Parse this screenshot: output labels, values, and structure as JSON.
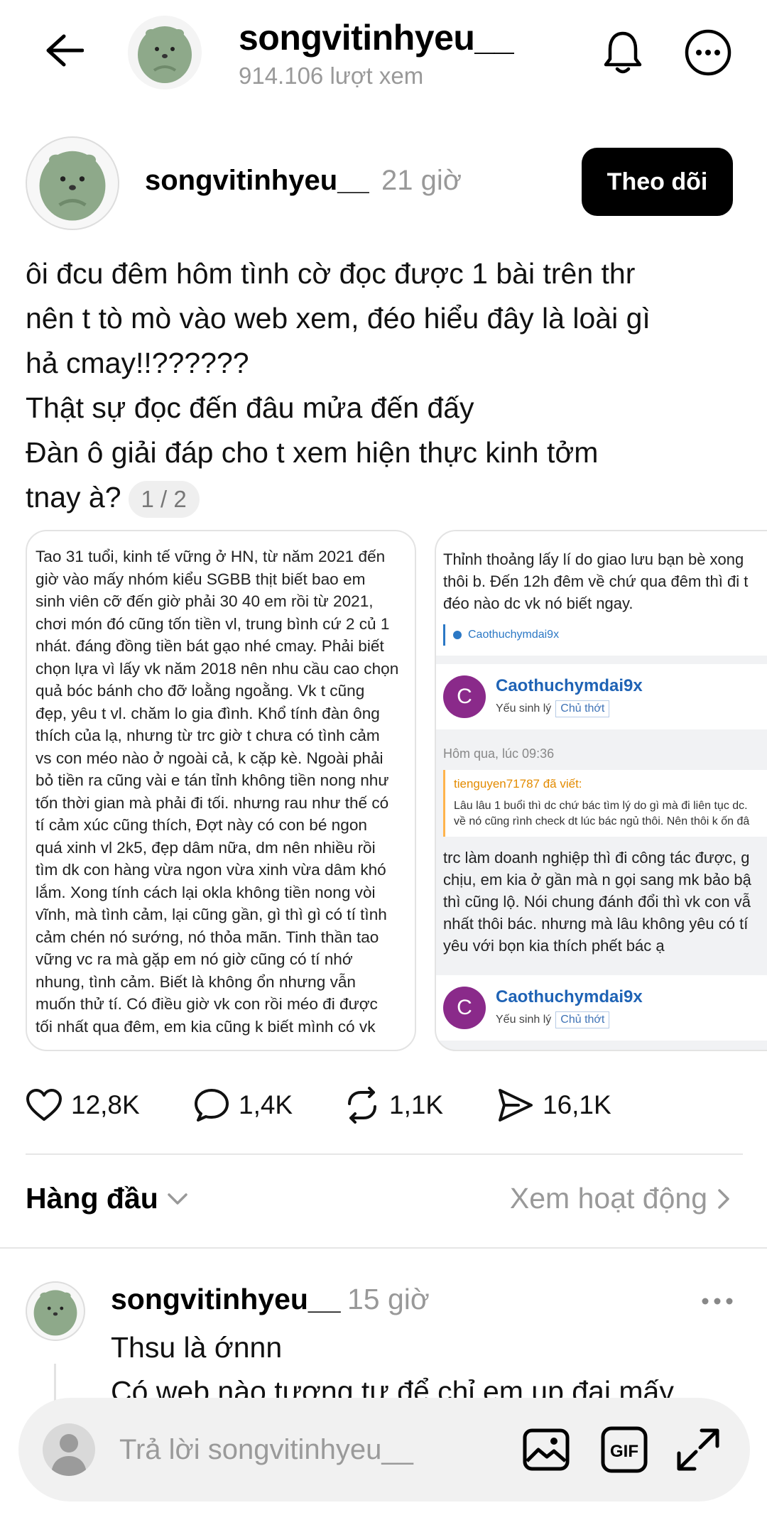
{
  "header": {
    "title": "songvitinhyeu__",
    "views": "914.106 lượt xem"
  },
  "post": {
    "author": "songvitinhyeu__",
    "time": "21 giờ",
    "follow_label": "Theo dõi",
    "text_lines": [
      "ôi đcu đêm hôm tình cờ đọc được 1 bài trên thr",
      "nên t tò mò vào web xem, đéo hiểu đây là loài gì",
      "hả cmay!!??????",
      "Thật sự đọc đến đâu mửa đến đấy",
      "Đàn ô giải đáp cho t xem hiện thực kinh tởm",
      "tnay à?"
    ],
    "image_counter": "1 / 2",
    "image1_lines": [
      "Tao 31 tuổi, kinh tế vững ở HN, từ năm 2021 đến",
      "giờ vào mấy nhóm kiểu SGBB thịt biết bao em",
      "sinh viên cỡ đến giờ phải 30 40 em rồi từ 2021,",
      "chơi món đó cũng tốn tiền vl, trung bình cứ 2 củ 1",
      "nhát. đáng đồng tiền bát gạo nhé cmay. Phải biết",
      "chọn lựa vì lấy vk năm 2018 nên nhu cầu cao chọn",
      "quả bóc bánh cho đỡ loằng ngoằng. Vk t cũng",
      "đẹp, yêu t vl. chăm lo gia đình. Khổ tính đàn ông",
      "thích của lạ, nhưng từ trc giờ t chưa có tình cảm",
      "vs con méo nào ở ngoài cả, k cặp kè. Ngoài phải",
      "bỏ tiền ra cũng vài e tán tỉnh không tiền nong như",
      "tốn thời gian mà phải đi tối. nhưng rau như thế có",
      "tí cảm xúc cũng thích, Đợt này có con bé ngon",
      "quá xinh vl 2k5, đẹp dâm nữa, dm nên nhiều rồi",
      "tìm dk con hàng vừa ngon vừa xinh vừa dâm khó",
      "lắm. Xong tính cách lại okla không tiền nong vòi",
      "vĩnh, mà tình cảm, lại cũng gần, gì thì gì có tí tình",
      "cảm chén nó sướng, nó thỏa mãn. Tinh thần tao",
      "vững vc ra mà gặp em nó giờ cũng có tí nhớ",
      "nhung, tình cảm. Biết là không ổn nhưng vẫn",
      "muốn thử tí. Có điều giờ vk con rồi méo đi được",
      "tối nhất qua đêm, em kia cũng k biết mình có vk"
    ],
    "image2": {
      "top_lines": [
        "Thỉnh thoảng lấy lí do giao lưu bạn bè xong",
        "thôi b. Đến 12h đêm về chứ qua đêm thì đi t",
        "đéo nào dc vk nó biết ngay."
      ],
      "quote_link": "Caothuchymdai9x",
      "user_name": "Caothuchymdai9x",
      "user_initial": "C",
      "user_role": "Yếu sinh lý",
      "user_badge": "Chủ thớt",
      "date": "Hôm qua, lúc 09:36",
      "quote_header": "tienguyen71787 đã viết:",
      "quote_lines": [
        "Lâu lâu 1 buổi thì dc chứ bác tìm lý do gì mà đi liên tục dc.",
        "về nó cũng rình check dt lúc bác ngủ thôi. Nên thôi k ốn đâ"
      ],
      "reply_lines": [
        "trc làm doanh nghiệp thì đi công tác được, g",
        "chịu, em kia ở gần mà n gọi sang mk bảo bậ",
        "thì cũng lộ. Nói chung đánh đổi thì vk con vẫ",
        "nhất thôi bác. nhưng mà lâu không yêu có tí",
        "yêu với bọn kia thích phết bác ạ"
      ],
      "user2_name": "Caothuchymdai9x",
      "user2_initial": "C",
      "user2_role": "Yếu sinh lý",
      "user2_badge": "Chủ thớt"
    },
    "stats": {
      "likes": "12,8K",
      "comments": "1,4K",
      "reposts": "1,1K",
      "shares": "16,1K"
    }
  },
  "replies_header": {
    "sort_label": "Hàng đầu",
    "activity_label": "Xem hoạt động"
  },
  "reply": {
    "author": "songvitinhyeu__",
    "time": "15 giờ",
    "line1": "Thsu là ớnnn",
    "line2": "Có web nào tương tự để chỉ em up đại mấy"
  },
  "composer": {
    "placeholder": "Trả lời songvitinhyeu__"
  }
}
